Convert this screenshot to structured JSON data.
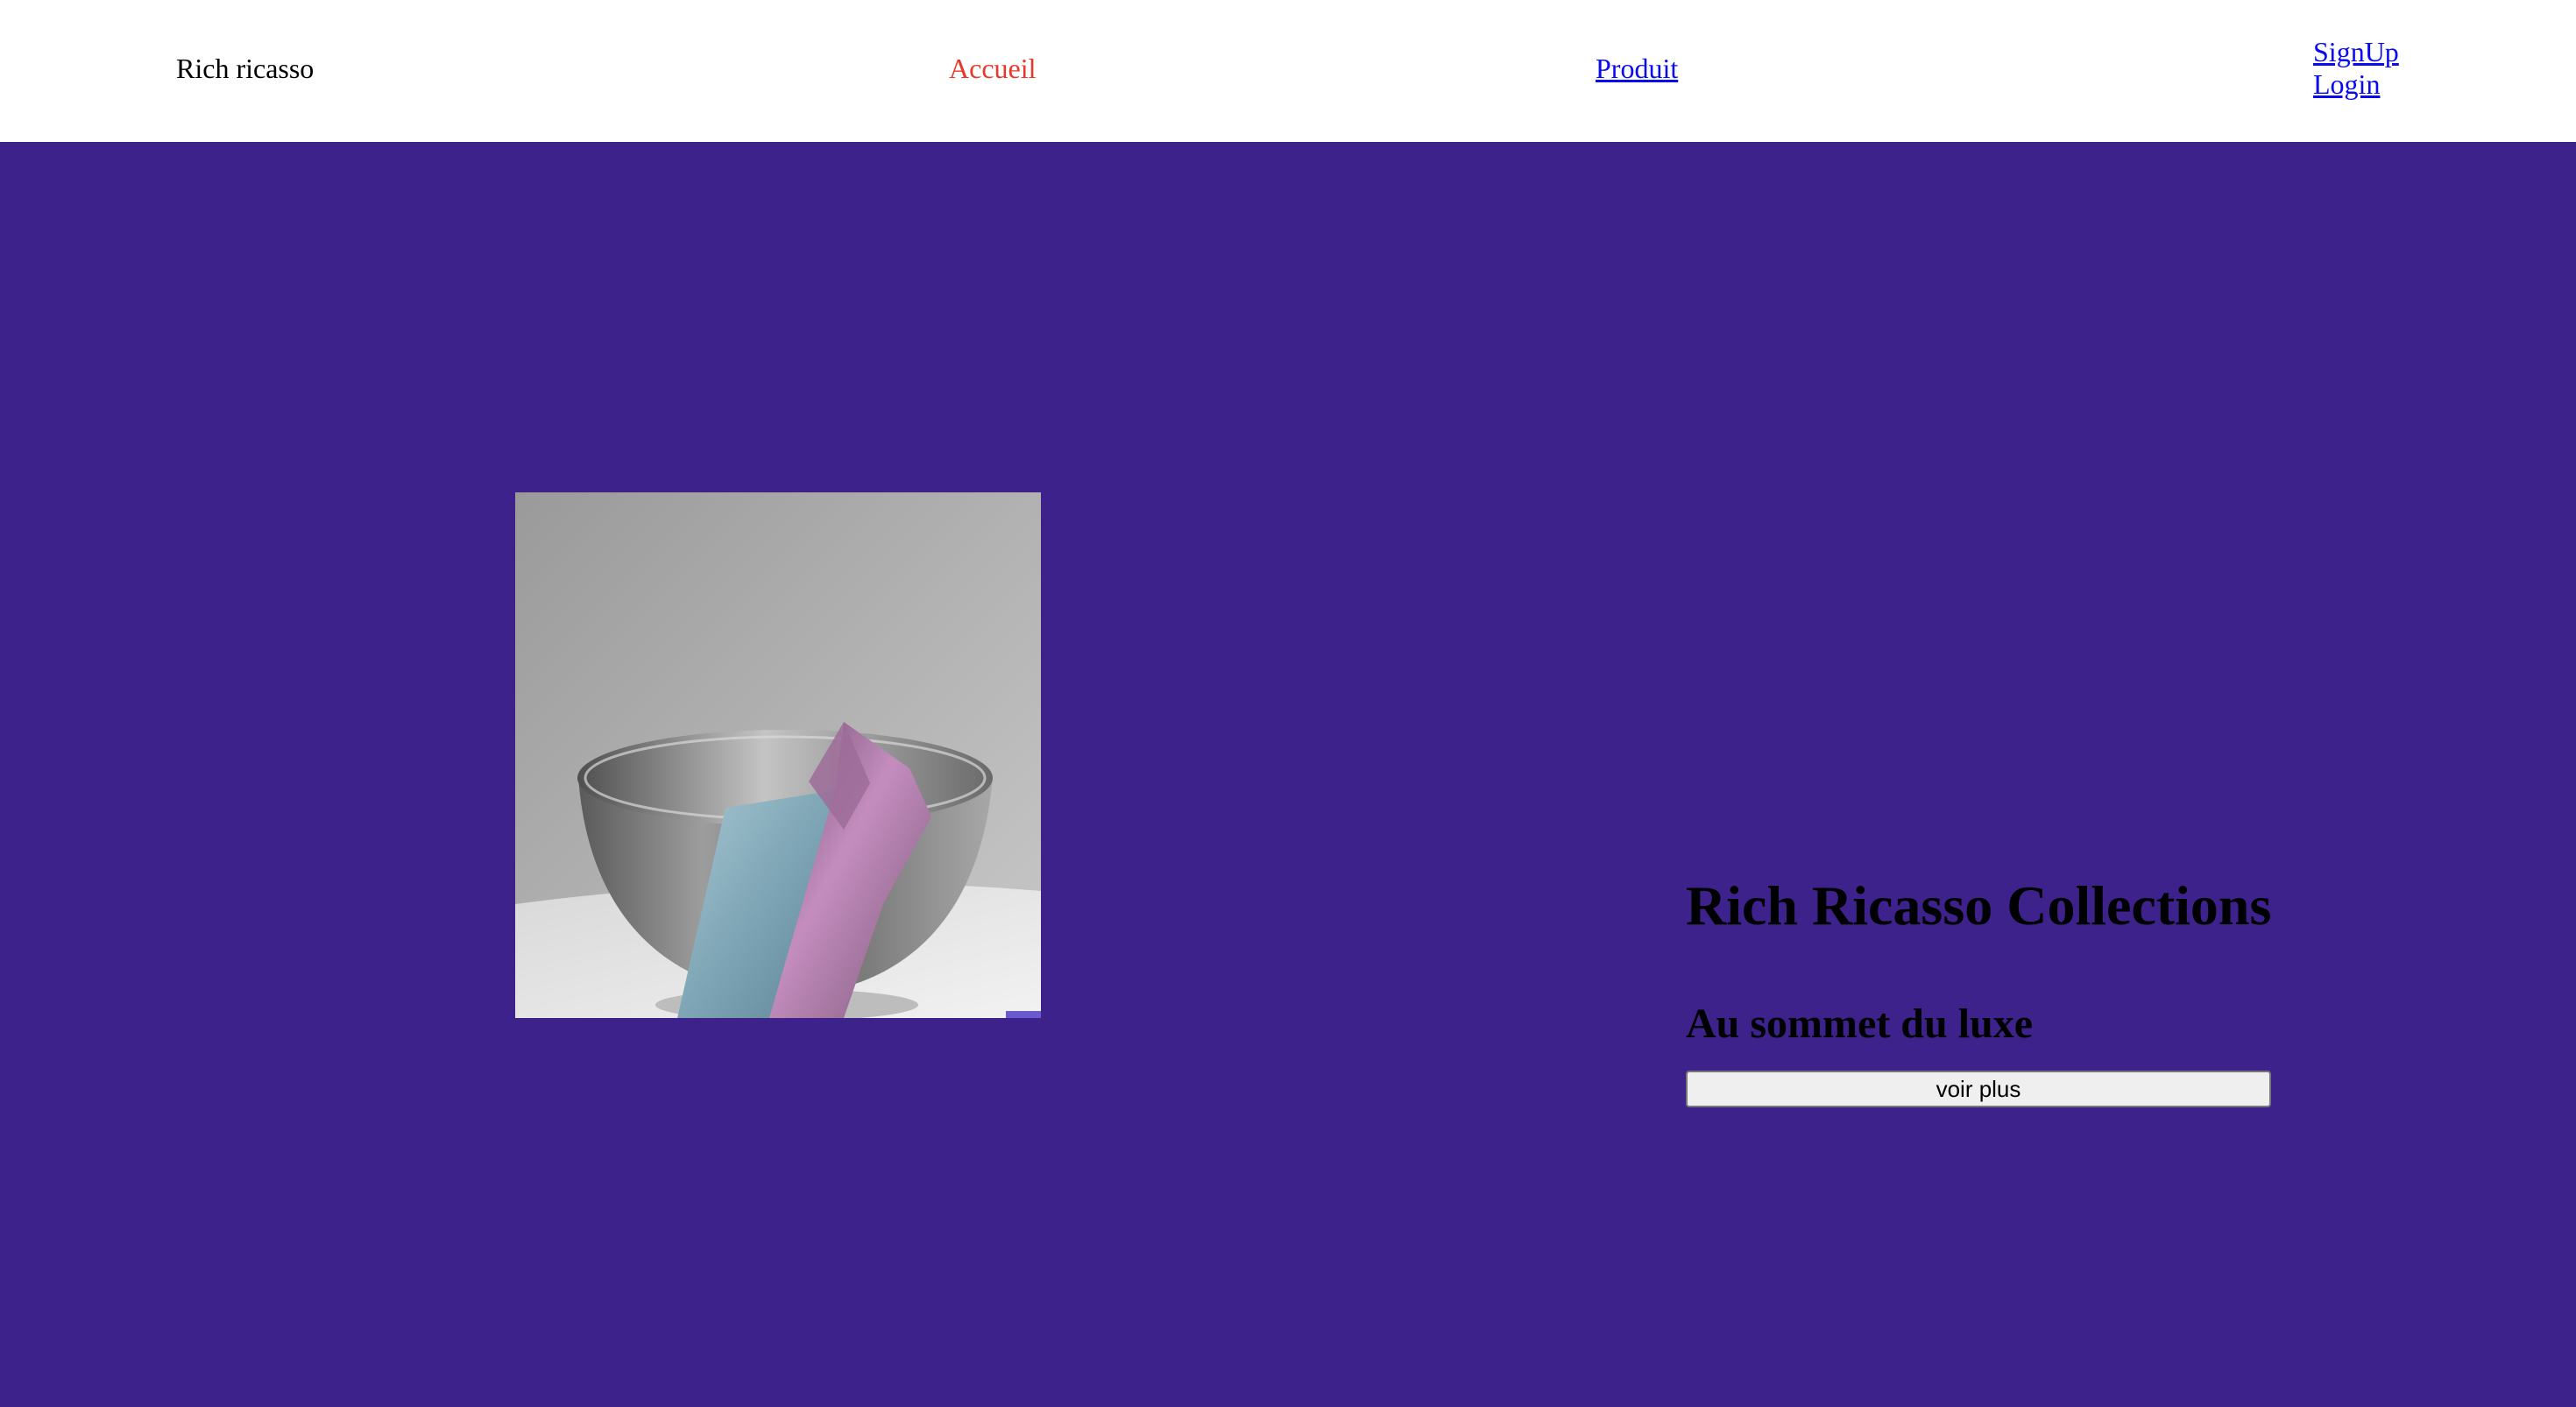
{
  "header": {
    "brand": "Rich ricasso",
    "nav": {
      "home": "Accueil",
      "product": "Produit",
      "signup": "SignUp",
      "login": "Login"
    }
  },
  "hero": {
    "title": "Rich Ricasso Collections",
    "subtitle": "Au sommet du luxe",
    "button_label": "voir plus"
  },
  "colors": {
    "hero_background": "#3c228a",
    "header_background": "#ffffff",
    "active_nav": "#e8382a",
    "link": "#0a0aee"
  }
}
